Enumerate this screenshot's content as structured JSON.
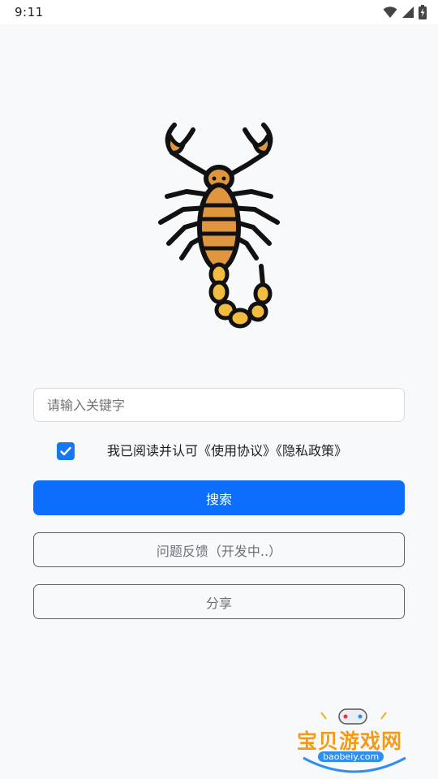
{
  "status_bar": {
    "time": "9:11",
    "icons": [
      "wifi-icon",
      "cellular-signal-icon",
      "battery-charging-icon"
    ]
  },
  "logo": {
    "icon": "scorpion-icon"
  },
  "search": {
    "placeholder": "请输入关键字",
    "value": ""
  },
  "agreement": {
    "checked": true,
    "text": "我已阅读并认可《使用协议》《隐私政策》"
  },
  "buttons": {
    "search_label": "搜索",
    "feedback_label": "问题反馈（开发中..）",
    "share_label": "分享"
  },
  "watermark": {
    "title": "宝贝游戏网",
    "url": "baobeiy.com"
  },
  "colors": {
    "primary": "#0d6efd",
    "checkbox": "#1677f5",
    "background": "#f8f9fb",
    "scorpion_body": "#e0963f",
    "scorpion_stinger": "#f2bd3f"
  }
}
